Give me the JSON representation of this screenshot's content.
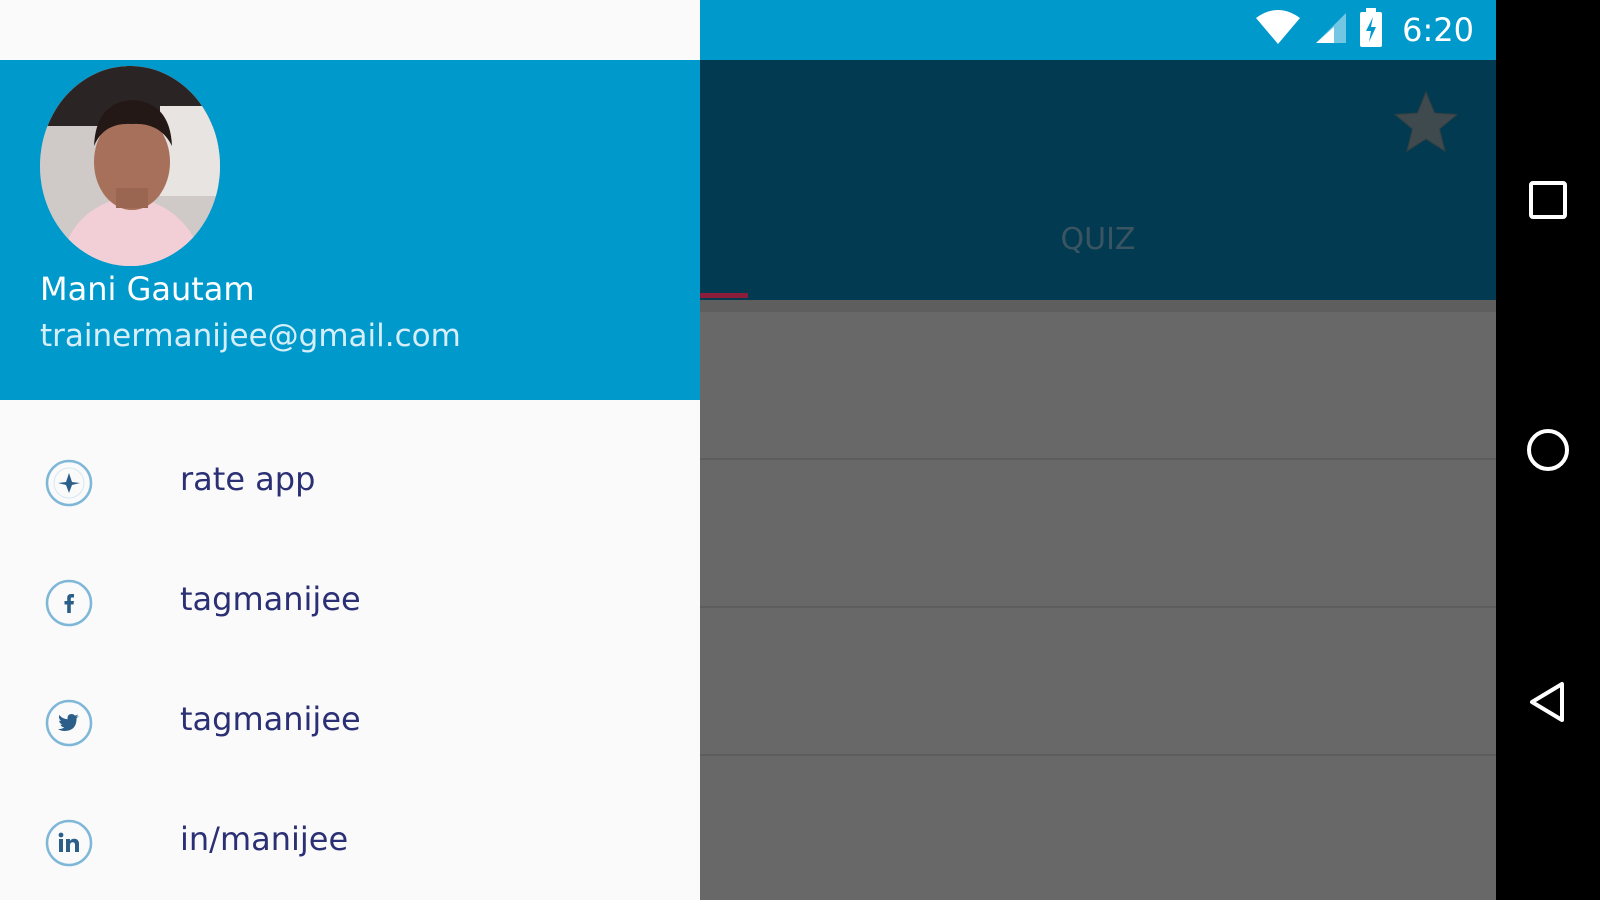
{
  "status_bar": {
    "time": "6:20",
    "icons": [
      "wifi-icon",
      "cellular-signal-icon",
      "battery-charging-icon"
    ]
  },
  "app": {
    "tab": "QUIZ",
    "toolbar_icon": "star-icon",
    "colors": {
      "toolbar": "#023a52",
      "scrim_content": "#676767",
      "tab_indicator": "#8a1d3a"
    }
  },
  "drawer": {
    "header_color": "#0099cc",
    "user_name": "Mani Gautam",
    "user_email": "trainermanijee@gmail.com",
    "items": [
      {
        "label": "rate app",
        "icon": "rate-app-icon"
      },
      {
        "label": "tagmanijee",
        "icon": "facebook-icon"
      },
      {
        "label": "tagmanijee",
        "icon": "twitter-icon"
      },
      {
        "label": "in/manijee",
        "icon": "linkedin-icon"
      }
    ]
  },
  "nav_bar": {
    "buttons": [
      "recents-square-icon",
      "home-circle-icon",
      "back-triangle-icon"
    ]
  }
}
